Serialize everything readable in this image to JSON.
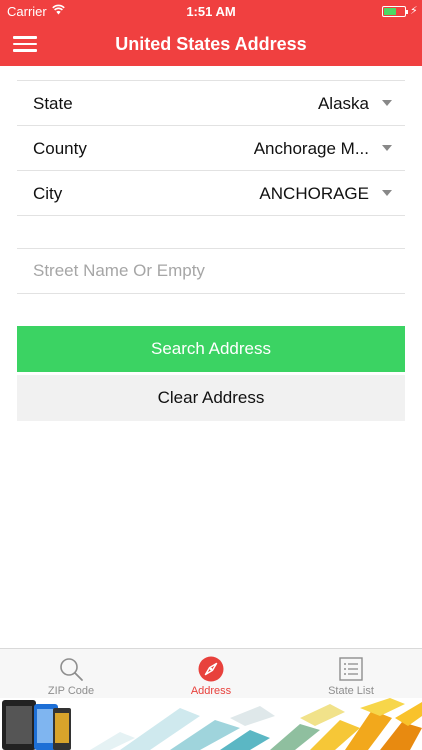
{
  "status_bar": {
    "carrier": "Carrier",
    "time": "1:51 AM",
    "battery_color": "#4cd964",
    "icons": [
      "wifi-icon",
      "battery-icon",
      "charging-icon"
    ]
  },
  "nav": {
    "title": "United States Address",
    "menu_icon": "hamburger-menu-icon",
    "color": "#f04040"
  },
  "form": {
    "state": {
      "label": "State",
      "value": "Alaska"
    },
    "county": {
      "label": "County",
      "value": "Anchorage M..."
    },
    "city": {
      "label": "City",
      "value": "ANCHORAGE"
    },
    "street": {
      "placeholder": "Street Name Or Empty",
      "value": ""
    }
  },
  "buttons": {
    "search": {
      "label": "Search Address",
      "color": "#3bd363"
    },
    "clear": {
      "label": "Clear Address"
    }
  },
  "tabs": [
    {
      "label": "ZIP Code",
      "icon": "magnifier-icon",
      "active": false
    },
    {
      "label": "Address",
      "icon": "compass-icon",
      "active": true
    },
    {
      "label": "State List",
      "icon": "list-icon",
      "active": false
    }
  ],
  "ad_banner": {
    "icon": "ad-banner-image"
  }
}
